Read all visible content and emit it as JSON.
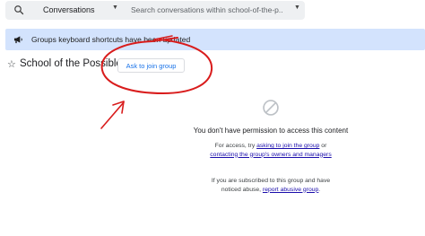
{
  "search": {
    "scope_label": "Conversations",
    "placeholder": "Search conversations within school-of-the-p..."
  },
  "banner": {
    "text": "Groups keyboard shortcuts have been updated"
  },
  "group": {
    "title": "School of the Possible",
    "join_button": "Ask to join group"
  },
  "permission": {
    "title": "You don't have permission to access this content",
    "p1_before": "For access, try ",
    "p1_link1": "asking to join the group",
    "p1_mid": " or ",
    "p1_link2": "contacting the group's owners and managers",
    "p2_before": "If you are subscribed to this group and have noticed abuse, ",
    "p2_link": "report abusive group",
    "p2_after": "."
  },
  "icons": {
    "search": "search-icon",
    "scope_dropdown": "caret-down-icon",
    "search_options": "caret-down-icon",
    "banner": "megaphone-icon",
    "favorite": "star-outline-icon",
    "no_access": "block-icon"
  },
  "colors": {
    "banner_bg": "#d3e3fd",
    "link": "#1a0dab",
    "button_text": "#1a73e8",
    "annotation": "#d91c1c"
  }
}
